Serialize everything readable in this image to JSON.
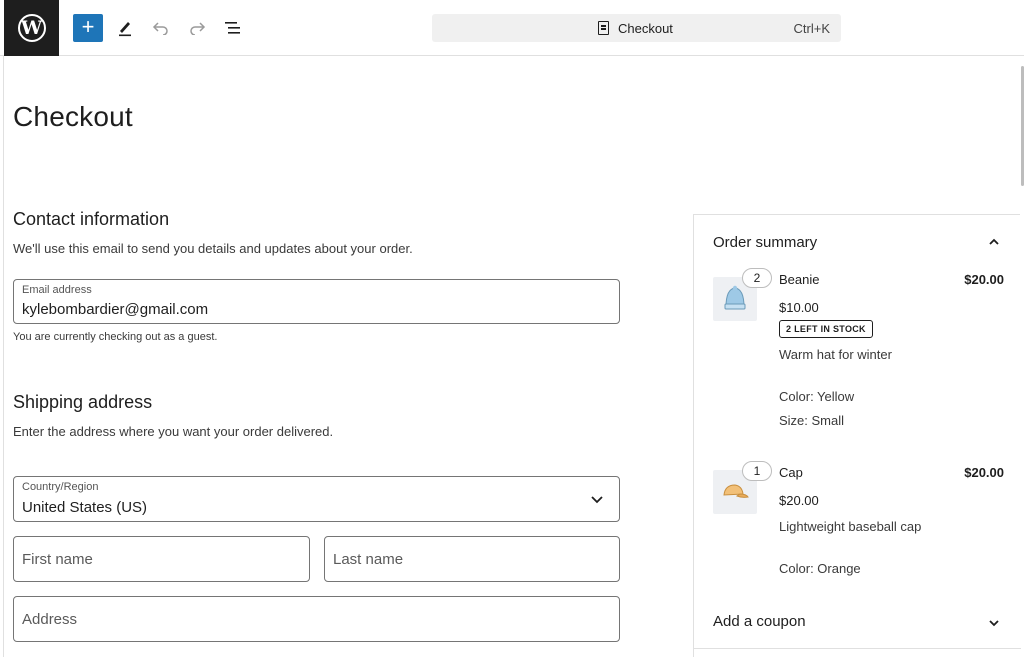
{
  "toolbar": {
    "logo": "W",
    "add_icon": "plus-icon",
    "add_label": "+",
    "edit_icon": "pencil-icon",
    "undo_icon": "undo-icon",
    "redo_icon": "redo-icon",
    "list_icon": "document-overview-icon",
    "command_title": "Checkout",
    "command_shortcut": "Ctrl+K",
    "accent_color": "#1e75b8"
  },
  "page": {
    "title": "Checkout"
  },
  "contact": {
    "heading": "Contact information",
    "description": "We'll use this email to send you details and updates about your order.",
    "email_label": "Email address",
    "email_value": "kylebombardier@gmail.com",
    "guest_note": "You are currently checking out as a guest."
  },
  "shipping": {
    "heading": "Shipping address",
    "description": "Enter the address where you want your order delivered.",
    "country_label": "Country/Region",
    "country_value": "United States (US)",
    "first_name_placeholder": "First name",
    "last_name_placeholder": "Last name",
    "address_placeholder": "Address"
  },
  "summary": {
    "title": "Order summary",
    "items": [
      {
        "quantity": "2",
        "name": "Beanie",
        "total": "$20.00",
        "price": "$10.00",
        "stock_badge": "2 LEFT IN STOCK",
        "description": "Warm hat for winter",
        "attributes": [
          "Color: Yellow",
          "Size: Small"
        ],
        "thumb_icon": "beanie-icon"
      },
      {
        "quantity": "1",
        "name": "Cap",
        "total": "$20.00",
        "price": "$20.00",
        "description": "Lightweight baseball cap",
        "attributes": [
          "Color: Orange"
        ],
        "thumb_icon": "cap-icon"
      }
    ],
    "coupon_label": "Add a coupon"
  }
}
